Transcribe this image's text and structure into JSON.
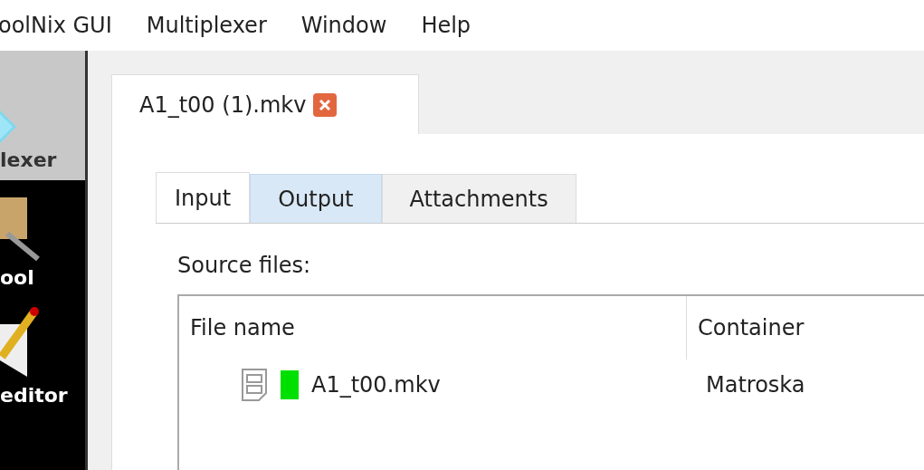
{
  "menu": [
    "oolNix GUI",
    "Multiplexer",
    "Window",
    "Help"
  ],
  "sidebar": {
    "items": [
      {
        "label": "lexer",
        "selected": true,
        "kind": "multiplexer"
      },
      {
        "label": "ool",
        "selected": false,
        "kind": "tool"
      },
      {
        "label": "editor",
        "selected": false,
        "kind": "editor"
      }
    ]
  },
  "document_tab": {
    "label": "A1_t00 (1).mkv"
  },
  "tabs": [
    {
      "label": "Input",
      "selected": true,
      "hovered": false
    },
    {
      "label": "Output",
      "selected": false,
      "hovered": true
    },
    {
      "label": "Attachments",
      "selected": false,
      "hovered": false
    }
  ],
  "source_files": {
    "label": "Source files:",
    "columns": [
      "File name",
      "Container"
    ],
    "rows": [
      {
        "file_name": "A1_t00.mkv",
        "container": "Matroska",
        "color": "#00e000"
      }
    ]
  }
}
